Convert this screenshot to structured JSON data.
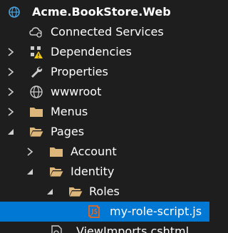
{
  "solution_explorer": {
    "project": {
      "label": "Acme.BookStore.Web",
      "icon": "web-project-icon"
    },
    "items": [
      {
        "label": "Connected Services",
        "icon": "cloud-gear-icon"
      },
      {
        "label": "Dependencies",
        "icon": "dependencies-warning-icon"
      },
      {
        "label": "Properties",
        "icon": "wrench-icon"
      },
      {
        "label": "wwwroot",
        "icon": "globe-icon"
      },
      {
        "label": "Menus",
        "icon": "folder-icon"
      },
      {
        "label": "Pages",
        "icon": "folder-open-icon"
      },
      {
        "label": "Account",
        "icon": "folder-icon"
      },
      {
        "label": "Identity",
        "icon": "folder-open-icon"
      },
      {
        "label": "Roles",
        "icon": "folder-open-icon"
      },
      {
        "label": "my-role-script.js",
        "icon": "javascript-file-icon"
      },
      {
        "label": "_ViewImports.cshtml",
        "icon": "razor-file-icon"
      }
    ]
  },
  "colors": {
    "background": "#1e1e1e",
    "selection": "#0078d4",
    "folder": "#dcb67a",
    "js_icon": "#e8651c",
    "warning": "#f2c811"
  }
}
